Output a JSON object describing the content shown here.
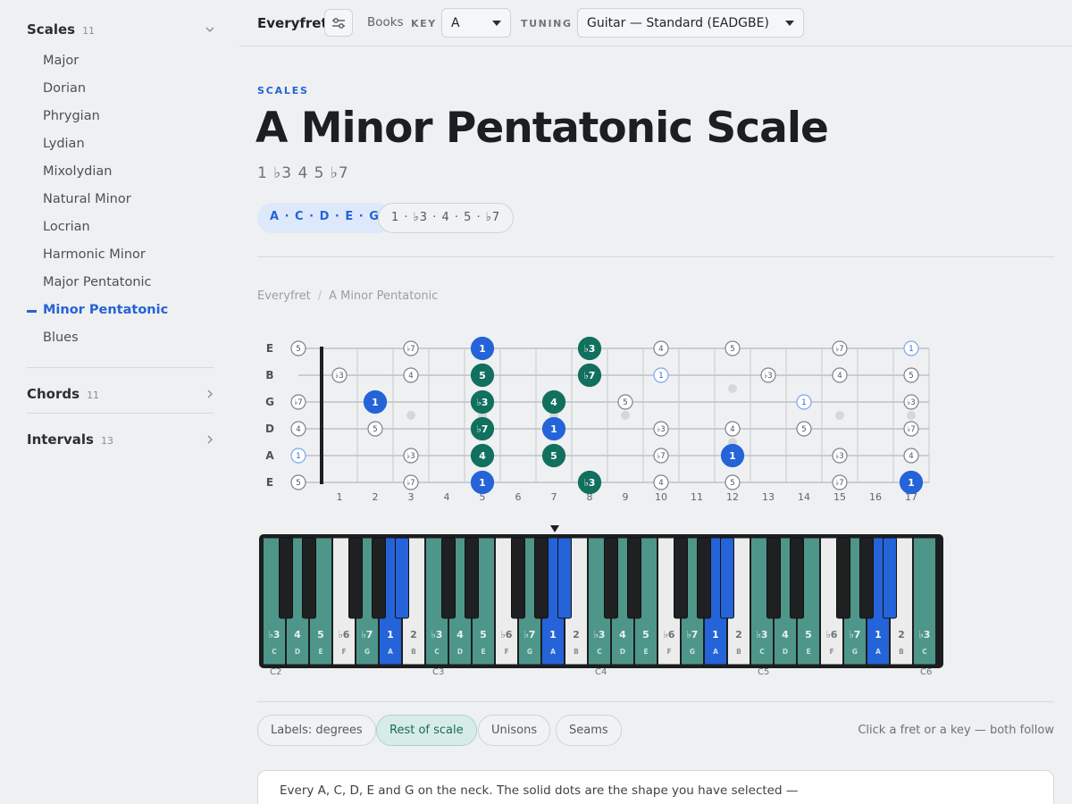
{
  "sidebar": {
    "scales": {
      "title": "Scales",
      "count": "11"
    },
    "items": [
      "Major",
      "Dorian",
      "Phrygian",
      "Lydian",
      "Mixolydian",
      "Natural Minor",
      "Locrian",
      "Harmonic Minor",
      "Major Pentatonic",
      "Minor Pentatonic",
      "Blues"
    ],
    "active_item": "Minor Pentatonic",
    "chords": {
      "title": "Chords",
      "count": "11"
    },
    "intervals": {
      "title": "Intervals",
      "count": "13"
    }
  },
  "topbar": {
    "brand": "Everyfret",
    "filter_icon": "sliders-icon",
    "books": "Books",
    "key_label": "KEY",
    "key_value": "A",
    "tuning_label": "TUNING",
    "tuning_value": "Guitar — Standard (EADGBE)"
  },
  "header": {
    "eyebrow": "SCALES",
    "title": "A Minor Pentatonic Scale",
    "formula": "1 ♭3 4 5 ♭7",
    "notes_pill": "A · C · D · E · G",
    "degrees_pill": "1 · ♭3 · 4 · 5 · ♭7"
  },
  "breadcrumb": {
    "root": "Everyfret",
    "current": "A Minor Pentatonic"
  },
  "fretboard": {
    "strings": [
      "E",
      "B",
      "G",
      "D",
      "A",
      "E"
    ],
    "fret_numbers": [
      "1",
      "2",
      "3",
      "4",
      "5",
      "6",
      "7",
      "8",
      "9",
      "10",
      "11",
      "12",
      "13",
      "14",
      "15",
      "16",
      "17"
    ],
    "open_notes": [
      "5",
      "",
      "♭7",
      "4",
      "1",
      "5"
    ],
    "dots": [
      {
        "s": 0,
        "f": 3,
        "l": "♭7",
        "t": "rest"
      },
      {
        "s": 0,
        "f": 5,
        "l": "1",
        "t": "root"
      },
      {
        "s": 0,
        "f": 8,
        "l": "♭3",
        "t": "shape"
      },
      {
        "s": 0,
        "f": 10,
        "l": "4",
        "t": "rest"
      },
      {
        "s": 0,
        "f": 12,
        "l": "5",
        "t": "rest"
      },
      {
        "s": 0,
        "f": 15,
        "l": "♭7",
        "t": "rest"
      },
      {
        "s": 0,
        "f": 17,
        "l": "1",
        "t": "rootring"
      },
      {
        "s": 1,
        "f": 1,
        "l": "♭3",
        "t": "rest"
      },
      {
        "s": 1,
        "f": 3,
        "l": "4",
        "t": "rest"
      },
      {
        "s": 1,
        "f": 5,
        "l": "5",
        "t": "shape"
      },
      {
        "s": 1,
        "f": 8,
        "l": "♭7",
        "t": "shape"
      },
      {
        "s": 1,
        "f": 10,
        "l": "1",
        "t": "rootring"
      },
      {
        "s": 1,
        "f": 13,
        "l": "♭3",
        "t": "rest"
      },
      {
        "s": 1,
        "f": 15,
        "l": "4",
        "t": "rest"
      },
      {
        "s": 1,
        "f": 17,
        "l": "5",
        "t": "rest"
      },
      {
        "s": 2,
        "f": 2,
        "l": "1",
        "t": "root"
      },
      {
        "s": 2,
        "f": 5,
        "l": "♭3",
        "t": "shape"
      },
      {
        "s": 2,
        "f": 7,
        "l": "4",
        "t": "shape"
      },
      {
        "s": 2,
        "f": 9,
        "l": "5",
        "t": "rest"
      },
      {
        "s": 2,
        "f": 14,
        "l": "1",
        "t": "rootring"
      },
      {
        "s": 2,
        "f": 17,
        "l": "♭3",
        "t": "rest"
      },
      {
        "s": 3,
        "f": 2,
        "l": "5",
        "t": "rest"
      },
      {
        "s": 3,
        "f": 5,
        "l": "♭7",
        "t": "shape"
      },
      {
        "s": 3,
        "f": 7,
        "l": "1",
        "t": "root"
      },
      {
        "s": 3,
        "f": 10,
        "l": "♭3",
        "t": "rest"
      },
      {
        "s": 3,
        "f": 12,
        "l": "4",
        "t": "rest"
      },
      {
        "s": 3,
        "f": 14,
        "l": "5",
        "t": "rest"
      },
      {
        "s": 3,
        "f": 17,
        "l": "♭7",
        "t": "rest"
      },
      {
        "s": 4,
        "f": 3,
        "l": "♭3",
        "t": "rest"
      },
      {
        "s": 4,
        "f": 5,
        "l": "4",
        "t": "shape"
      },
      {
        "s": 4,
        "f": 7,
        "l": "5",
        "t": "shape"
      },
      {
        "s": 4,
        "f": 10,
        "l": "♭7",
        "t": "rest"
      },
      {
        "s": 4,
        "f": 12,
        "l": "1",
        "t": "root"
      },
      {
        "s": 4,
        "f": 15,
        "l": "♭3",
        "t": "rest"
      },
      {
        "s": 4,
        "f": 17,
        "l": "4",
        "t": "rest"
      },
      {
        "s": 5,
        "f": 3,
        "l": "♭7",
        "t": "rest"
      },
      {
        "s": 5,
        "f": 5,
        "l": "1",
        "t": "root"
      },
      {
        "s": 5,
        "f": 8,
        "l": "♭3",
        "t": "shape"
      },
      {
        "s": 5,
        "f": 10,
        "l": "4",
        "t": "rest"
      },
      {
        "s": 5,
        "f": 12,
        "l": "5",
        "t": "rest"
      },
      {
        "s": 5,
        "f": 15,
        "l": "♭7",
        "t": "rest"
      },
      {
        "s": 5,
        "f": 17,
        "l": "1",
        "t": "root"
      }
    ],
    "inlays_single": [
      3,
      5,
      7,
      9,
      15,
      17
    ],
    "inlays_double": [
      12
    ]
  },
  "piano": {
    "octaves": [
      "C2",
      "C3",
      "C4",
      "C5",
      "C6"
    ],
    "white_keys": [
      {
        "n": "C",
        "d": "♭3",
        "t": "scale"
      },
      {
        "n": "D",
        "d": "4",
        "t": "scale"
      },
      {
        "n": "E",
        "d": "5",
        "t": "scale"
      },
      {
        "n": "F",
        "d": "♭6",
        "t": "off"
      },
      {
        "n": "G",
        "d": "♭7",
        "t": "scale"
      },
      {
        "n": "A",
        "d": "1",
        "t": "root"
      },
      {
        "n": "B",
        "d": "2",
        "t": "off"
      },
      {
        "n": "C",
        "d": "♭3",
        "t": "scale"
      },
      {
        "n": "D",
        "d": "4",
        "t": "scale"
      },
      {
        "n": "E",
        "d": "5",
        "t": "scale"
      },
      {
        "n": "F",
        "d": "♭6",
        "t": "off"
      },
      {
        "n": "G",
        "d": "♭7",
        "t": "scale"
      },
      {
        "n": "A",
        "d": "1",
        "t": "root"
      },
      {
        "n": "B",
        "d": "2",
        "t": "off"
      },
      {
        "n": "C",
        "d": "♭3",
        "t": "scale"
      },
      {
        "n": "D",
        "d": "4",
        "t": "scale"
      },
      {
        "n": "E",
        "d": "5",
        "t": "scale"
      },
      {
        "n": "F",
        "d": "♭6",
        "t": "off"
      },
      {
        "n": "G",
        "d": "♭7",
        "t": "scale"
      },
      {
        "n": "A",
        "d": "1",
        "t": "root"
      },
      {
        "n": "B",
        "d": "2",
        "t": "off"
      },
      {
        "n": "C",
        "d": "♭3",
        "t": "scale"
      },
      {
        "n": "D",
        "d": "4",
        "t": "scale"
      },
      {
        "n": "E",
        "d": "5",
        "t": "scale"
      },
      {
        "n": "F",
        "d": "♭6",
        "t": "off"
      },
      {
        "n": "G",
        "d": "♭7",
        "t": "scale"
      },
      {
        "n": "A",
        "d": "1",
        "t": "root"
      },
      {
        "n": "B",
        "d": "2",
        "t": "off"
      },
      {
        "n": "C",
        "d": "♭3",
        "t": "scale"
      }
    ]
  },
  "controls": {
    "labels": "Labels: degrees",
    "rest": "Rest of scale",
    "unisons": "Unisons",
    "seams": "Seams",
    "hint": "Click a fret or a key — both follow"
  },
  "card": {
    "text": "Every A, C, D, E and G on the neck. The solid dots are the shape you have selected —"
  },
  "colors": {
    "accent": "#2563d9",
    "shape": "#11705e",
    "scale_key": "#4e968a",
    "root": "#2563d9"
  }
}
